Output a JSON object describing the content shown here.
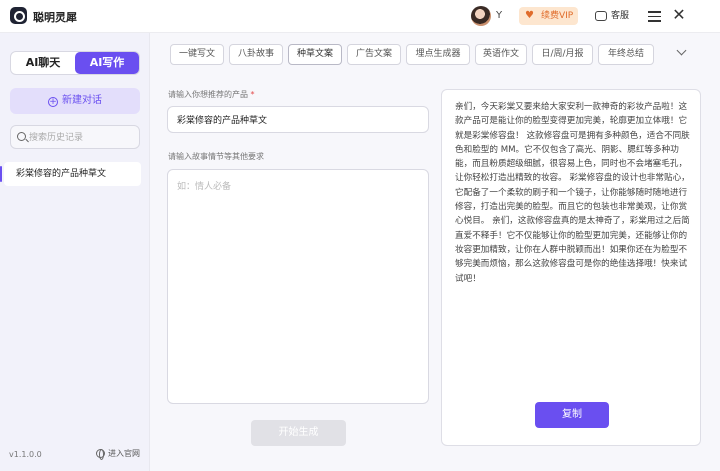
{
  "app": {
    "title": "聪明灵犀"
  },
  "header": {
    "username": "Y",
    "vip_label": "续费VIP",
    "service_label": "客服"
  },
  "sidebar": {
    "modes": [
      "AI聊天",
      "AI写作"
    ],
    "active_mode": "AI写作",
    "new_chat_label": "新建对话",
    "search_placeholder": "搜索历史记录",
    "history": [
      "彩棠修容的产品种草文"
    ],
    "version": "v1.1.0.0",
    "website_label": "进入官网"
  },
  "main": {
    "tabs": [
      "一键写文",
      "八卦故事",
      "种草文案",
      "广告文案",
      "埋点生成器",
      "英语作文",
      "日/周/月报",
      "年终总结"
    ],
    "active_tab": "种草文案",
    "product_label": "请输入你想推荐的产品",
    "required_mark": "*",
    "product_value": "彩棠修容的产品种草文",
    "detail_label": "请输入故事情节等其他要求",
    "detail_placeholder": "如：情人必备",
    "generate_label": "开始生成",
    "output_text": "亲们，今天彩棠又要来给大家安利一款神奇的彩妆产品啦！这款产品可是能让你的脸型变得更加完美，轮廓更加立体哦！它就是彩棠修容盘！ 这款修容盘可是拥有多种颜色，适合不同肤色和脸型的 MM。它不仅包含了高光、阴影、腮红等多种功能，而且粉质超级细腻，很容易上色，同时也不会堵塞毛孔，让你轻松打造出精致的妆容。 彩棠修容盘的设计也非常贴心，它配备了一个柔软的刷子和一个镜子，让你能够随时随地进行修容，打造出完美的脸型。而且它的包装也非常美观，让你赏心悦目。 亲们，这款修容盘真的是太神奇了，彩棠用过之后简直爱不释手！它不仅能够让你的脸型更加完美，还能够让你的妆容更加精致，让你在人群中脱颖而出！如果你还在为脸型不够完美而烦恼，那么这款修容盘可是你的绝佳选择哦！快来试试吧！",
    "copy_label": "复制"
  },
  "colors": {
    "accent": "#6a4ff0",
    "vip": "#e06c2b",
    "required": "#e34a4a"
  },
  "icons": [
    "logo-icon",
    "avatar",
    "vip-diamond-icon",
    "chat-icon",
    "menu-icon",
    "close-icon",
    "plus-circle-icon",
    "search-icon",
    "globe-icon",
    "chevron-down-icon"
  ]
}
